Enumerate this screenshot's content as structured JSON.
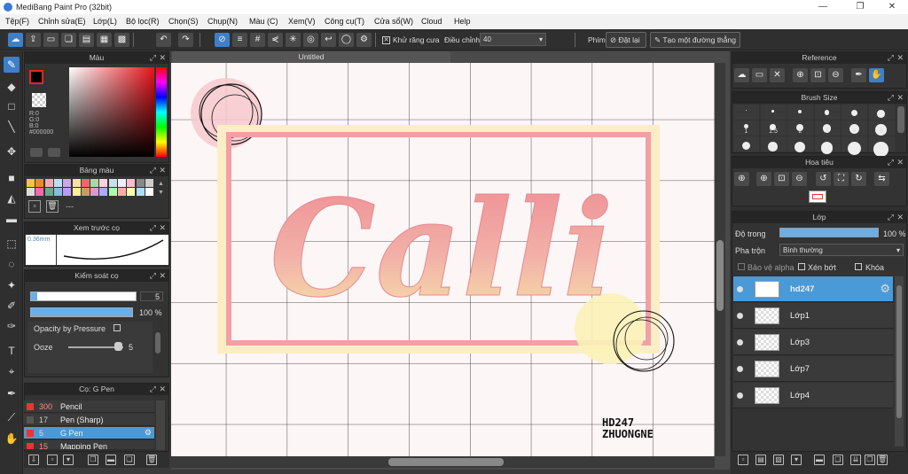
{
  "window": {
    "title": "MediBang Paint Pro (32bit)",
    "minimize": "—",
    "restore": "❐",
    "close": "✕"
  },
  "menu": [
    "Tệp(F)",
    "Chỉnh sửa(E)",
    "Lớp(L)",
    "Bộ lọc(R)",
    "Chọn(S)",
    "Chụp(N)",
    "Màu (C)",
    "Xem(V)",
    "Công cụ(T)",
    "Cửa sổ(W)",
    "Cloud",
    "Help"
  ],
  "toolbar": {
    "antialias_label": "Khử răng cưa",
    "adjust_label": "Điều chỉnh",
    "adjust_value": "40",
    "key_label": "Phím",
    "reset_label": "Đặt lại",
    "straight_label": "Tạo một đường thẳng"
  },
  "color_panel": {
    "title": "Màu",
    "r": "R:0",
    "g": "G:0",
    "b": "B:0",
    "hex": "#000000"
  },
  "palette_panel": {
    "title": "Bảng màu",
    "footer": "---"
  },
  "preview_panel": {
    "title": "Xem trước cọ",
    "size": "0.36mm"
  },
  "brush_control": {
    "title": "Kiểm soát cọ",
    "size_value": "5",
    "opacity_value": "100 %",
    "pressure_label": "Opacity by Pressure",
    "ooze_label": "Ooze",
    "ooze_value": "5"
  },
  "brush_list": {
    "title": "Cọ: G Pen",
    "items": [
      {
        "num": "300",
        "name": "Pencil"
      },
      {
        "num": "17",
        "name": "Pen (Sharp)"
      },
      {
        "num": "5",
        "name": "G Pen"
      },
      {
        "num": "15",
        "name": "Mapping Pen"
      }
    ]
  },
  "document": {
    "tab": "Untitled",
    "text": "Calli",
    "watermark_line1": "HD247",
    "watermark_line2": "ZHUONGNE"
  },
  "reference_panel": {
    "title": "Reference"
  },
  "brushsize_panel": {
    "title": "Brush Size",
    "sizes": [
      "1",
      "1.5",
      "2",
      "3",
      "4",
      "5"
    ]
  },
  "navigator_panel": {
    "title": "Hoa tiêu"
  },
  "layer_panel": {
    "title": "Lớp",
    "opacity_label": "Độ trong",
    "opacity_value": "100 %",
    "blend_label": "Pha trộn",
    "blend_value": "Bình thường",
    "protect_alpha": "Bảo vệ alpha",
    "clipping": "Xén bớt",
    "lock": "Khóa",
    "layers": [
      "hd247",
      "Lớp1",
      "Lớp3",
      "Lớp7",
      "Lớp4"
    ]
  },
  "colors": {
    "accent": "#4a9ad8",
    "selected_tool": "#3f7fc7",
    "frame": "#f2a0a6"
  }
}
